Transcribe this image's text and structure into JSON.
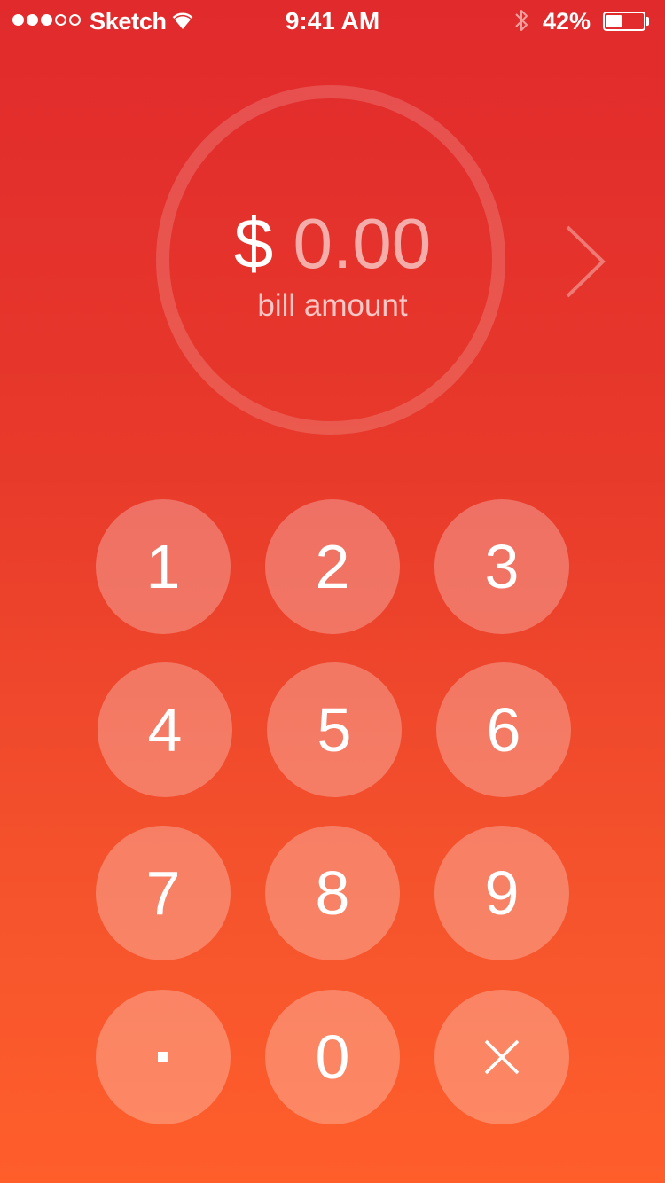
{
  "status_bar": {
    "carrier": "Sketch",
    "time": "9:41 AM",
    "battery_percent": "42%",
    "battery_level": 0.42,
    "signal_bars_filled": 3,
    "signal_bars_total": 5
  },
  "display": {
    "currency_symbol": "$",
    "amount": "0.00",
    "label": "bill amount"
  },
  "keypad": {
    "keys": [
      "1",
      "2",
      "3",
      "4",
      "5",
      "6",
      "7",
      "8",
      "9",
      ".",
      "0",
      "×"
    ]
  },
  "icons": {
    "next": "chevron-right-icon",
    "delete": "close-icon",
    "wifi": "wifi-icon",
    "bluetooth": "bluetooth-icon",
    "battery": "battery-icon"
  },
  "colors": {
    "gradient_top": "#e12a2c",
    "gradient_bottom": "#ff5e2b",
    "text": "#ffffff"
  }
}
